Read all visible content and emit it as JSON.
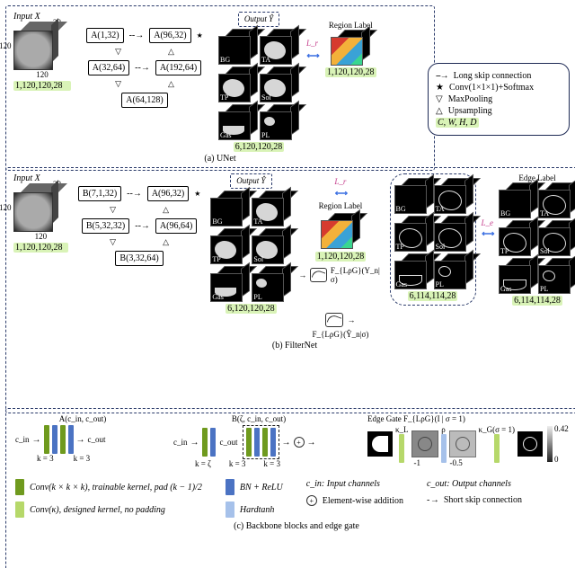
{
  "panels": {
    "a": "(a) UNet",
    "b": "(b) FilterNet",
    "c": "(c) Backbone blocks and edge gate"
  },
  "input": {
    "title": "Input X",
    "w": "120",
    "h": "120",
    "d": "28",
    "dims": "1,120,120,28"
  },
  "output": {
    "title": "Output Ŷ",
    "dims": "6,120,120,28"
  },
  "regions": {
    "title": "Region Label",
    "dims": "1,120,120,28"
  },
  "edge": {
    "title": "Edge Label",
    "dims": "6,114,114,28"
  },
  "edge_pred_dims": "6,114,114,28",
  "cube_labels": [
    "BG",
    "TA",
    "TP",
    "Sol",
    "Gas",
    "PL"
  ],
  "losses": {
    "r": "L_r",
    "e": "L_e"
  },
  "gate_up": "F_{LρG}(Y_n|σ)",
  "gate_dn": "F_{LρG}(Ŷ_n|σ)",
  "unet": {
    "a1": "A(1,32)",
    "a2": "A(96,32)",
    "a3": "A(32,64)",
    "a4": "A(192,64)",
    "a5": "A(64,128)"
  },
  "filternet": {
    "b1": "B(7,1,32)",
    "b2": "B(5,32,32)",
    "b3": "B(3,32,64)",
    "a1": "A(96,32)",
    "a2": "A(96,64)"
  },
  "right_legend": {
    "skip": "Long skip connection",
    "conv": "Conv(1×1×1)+Softmax",
    "maxpool": "MaxPooling",
    "up": "Upsampling",
    "dims": "C, W, H, D"
  },
  "partC": {
    "A_title": "A(c_in, c_out)",
    "B_title": "B(ζ, c_in, c_out)",
    "gate_title": "Edge Gate  F_{LρG}(I | σ = 1)",
    "cin_arrow": "c_in",
    "cout_arrow": "c_out",
    "k3": "k = 3",
    "kz": "k = ζ",
    "kL": "κ_L",
    "rho": "ρ",
    "kG": "κ_G(σ = 1)",
    "tickL": "-1",
    "tickM": "-0.5",
    "tickR": "0.42"
  },
  "bottom_legend": {
    "l1": "Conv(k × k × k), trainable kernel, pad (k − 1)/2",
    "l2": "Conv(κ), designed kernel, no padding",
    "l3": "BN + ReLU",
    "l4": "Hardtanh",
    "l5": "Element-wise addition",
    "l6": "Short skip connection",
    "cin": "c_in: Input channels",
    "cout": "c_out: Output channels"
  }
}
